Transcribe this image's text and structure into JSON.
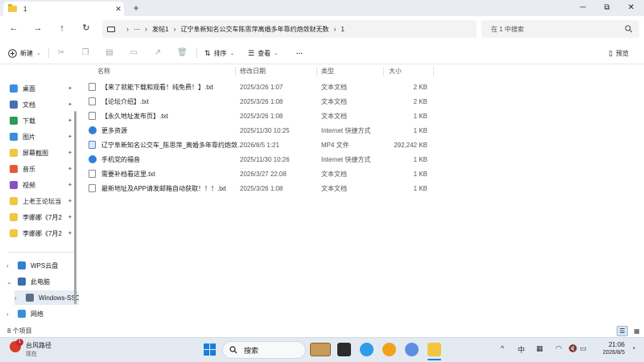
{
  "window": {
    "tab_title": "1",
    "tab_close": "✕",
    "new_tab": "+",
    "minimize": "─",
    "maximize": "⧉",
    "close": "✕"
  },
  "nav": {
    "back": "←",
    "forward": "→",
    "up": "↑",
    "refresh": "↻"
  },
  "address": {
    "more": "⋯",
    "crumbs": [
      "发帖1",
      "辽宁阜新知名公交车陈思萍离婚多年靠约炮敛财无数",
      "1"
    ],
    "sep": "›",
    "search_placeholder": "在 1 中搜索"
  },
  "toolbar": {
    "new_label": "新建",
    "sort_label": "排序",
    "view_label": "查看",
    "more": "···",
    "preview_label": "预览"
  },
  "sidebar": {
    "items": [
      {
        "label": "桌面",
        "pin": "✦",
        "color": "#3b8ee0"
      },
      {
        "label": "文档",
        "pin": "✦",
        "color": "#4a6fb0"
      },
      {
        "label": "下载",
        "pin": "✦",
        "color": "#2e9b57"
      },
      {
        "label": "图片",
        "pin": "✦",
        "color": "#3a8fd8"
      },
      {
        "label": "屏幕截图",
        "pin": "✦",
        "color": "#f4c542"
      },
      {
        "label": "音乐",
        "pin": "✦",
        "color": "#e35a3a"
      },
      {
        "label": "视频",
        "pin": "✦",
        "color": "#8a4fc9"
      },
      {
        "label": "上老王论坛当",
        "pin": "✦",
        "color": "#f4c542"
      },
      {
        "label": "李娜娜《7月2",
        "pin": "✦",
        "color": "#f4c542"
      },
      {
        "label": "李娜娜《7月2",
        "pin": "✦",
        "color": "#f4c542"
      }
    ],
    "tree": [
      {
        "label": "WPS云盘",
        "expander": "›",
        "color": "#2f7fd6"
      },
      {
        "label": "此电脑",
        "expander": "⌄",
        "color": "#3a6fb0"
      },
      {
        "label": "Windows-SSD",
        "expander": "›",
        "color": "#5c6f86"
      },
      {
        "label": "网络",
        "expander": "›",
        "color": "#3a8fd8"
      }
    ]
  },
  "columns": {
    "name": "名称",
    "modified": "修改日期",
    "type": "类型",
    "size": "大小"
  },
  "files": [
    {
      "name": "【来了就能下载和观看！纯免费！】.txt",
      "date": "2025/3/26 1:07",
      "type": "文本文档",
      "size": "2 KB",
      "kind": "txt"
    },
    {
      "name": "【论坛介绍】.txt",
      "date": "2025/3/26 1:08",
      "type": "文本文档",
      "size": "2 KB",
      "kind": "txt"
    },
    {
      "name": "【永久地址发布页】.txt",
      "date": "2025/3/26 1:08",
      "type": "文本文档",
      "size": "1 KB",
      "kind": "txt"
    },
    {
      "name": "更多资源",
      "date": "2025/11/30 10:25",
      "type": "Internet 快捷方式",
      "size": "1 KB",
      "kind": "link"
    },
    {
      "name": "辽宁阜新知名公交车_陈思萍_离婚多年靠约炮敛...",
      "date": "2026/8/5 1:21",
      "type": "MP4 文件",
      "size": "292,242 KB",
      "kind": "mp4"
    },
    {
      "name": "手机党的福音",
      "date": "2025/11/30 10:26",
      "type": "Internet 快捷方式",
      "size": "1 KB",
      "kind": "link"
    },
    {
      "name": "需要补档看这里.txt",
      "date": "2026/3/27 22:08",
      "type": "文本文档",
      "size": "1 KB",
      "kind": "txt"
    },
    {
      "name": "最新地址及APP请发邮箱自动获取！！！.txt",
      "date": "2025/3/26 1:08",
      "type": "文本文档",
      "size": "1 KB",
      "kind": "txt"
    }
  ],
  "status": {
    "count": "8 个项目"
  },
  "taskbar": {
    "weather_title": "台风路径",
    "weather_sub": "现在",
    "weather_badge": "1",
    "search_label": "搜索",
    "time": "21:06",
    "date": "2026/8/5",
    "tray_chevron": "^",
    "tray_lang": "中"
  }
}
